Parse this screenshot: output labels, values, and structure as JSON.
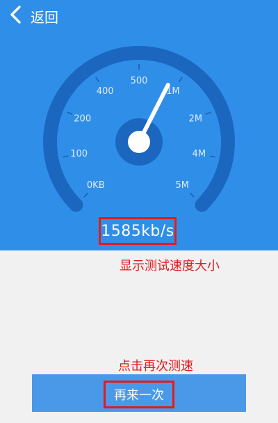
{
  "header": {
    "back_label": "返回",
    "back_icon": "chevron-left-icon"
  },
  "gauge": {
    "tick_labels": [
      "0KB",
      "100",
      "200",
      "400",
      "500",
      "1M",
      "2M",
      "4M",
      "5M"
    ],
    "speed_text": "1585kb/s",
    "needle_position": 0.6,
    "colors": {
      "background": "#2f8fe8",
      "arc": "#1b67c0",
      "needle": "#ffffff",
      "hub": "#1b67c0"
    }
  },
  "annotations": {
    "speed": "显示测试速度大小",
    "retry": "点击再次测速",
    "color": "#e31b1b"
  },
  "footer": {
    "retry_label": "再来一次"
  }
}
